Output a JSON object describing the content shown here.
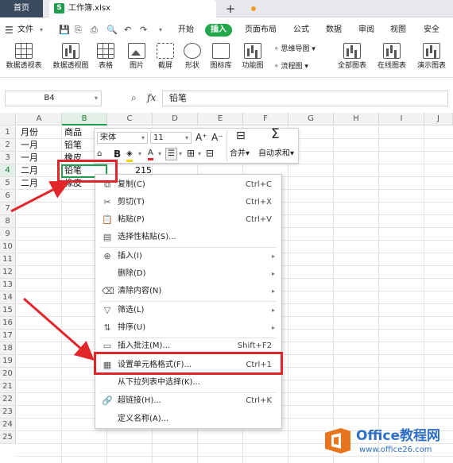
{
  "titlebar": {
    "home_tab": "首页",
    "file_badge": "S",
    "file_tab": "工作簿.xlsx",
    "new_tab": "+"
  },
  "menubar": {
    "file_menu": "文件",
    "tabs": [
      "开始",
      "插入",
      "页面布局",
      "公式",
      "数据",
      "审阅",
      "视图",
      "安全"
    ],
    "active_tab": "插入"
  },
  "ribbon": {
    "buttons": [
      "数据透视表",
      "数据透视图",
      "表格",
      "图片",
      "截屏",
      "形状",
      "图标库",
      "功能图",
      "全部图表",
      "在线图表",
      "演示图表"
    ],
    "small_buttons": [
      "思维导图",
      "流程图"
    ]
  },
  "formula_bar": {
    "cell_ref": "B4",
    "fx": "fx",
    "content": "铅笔"
  },
  "grid": {
    "columns": [
      "A",
      "B",
      "C",
      "D",
      "E",
      "F",
      "G",
      "H",
      "I",
      "J"
    ],
    "selected_column": "B",
    "rows": [
      "1",
      "2",
      "3",
      "4",
      "5",
      "6",
      "7",
      "8",
      "9",
      "10",
      "11",
      "12",
      "13",
      "14",
      "15",
      "16",
      "17",
      "18",
      "19",
      "20",
      "21",
      "22",
      "23",
      "24",
      "25"
    ],
    "selected_row": "4",
    "cells": {
      "A1": "月份",
      "A2": "一月",
      "A3": "一月",
      "A4": "二月",
      "A5": "二月",
      "B1": "商品",
      "B2": "铅笔",
      "B3": "橡皮",
      "B4": "铅笔",
      "B5": "橡皮",
      "C4": "215"
    }
  },
  "mini_toolbar": {
    "font_name": "宋体",
    "font_size": "11",
    "grow_font": "A⁺",
    "shrink_font": "A⁻",
    "bold": "B",
    "merge_label": "合并",
    "autosum_label": "自动求和"
  },
  "context_menu": {
    "items": [
      {
        "label": "复制(C)",
        "shortcut": "Ctrl+C",
        "icon": "copy-icon"
      },
      {
        "label": "剪切(T)",
        "shortcut": "Ctrl+X",
        "icon": "cut-icon"
      },
      {
        "label": "粘贴(P)",
        "shortcut": "Ctrl+V",
        "icon": "paste-icon"
      },
      {
        "label": "选择性粘贴(S)...",
        "shortcut": "",
        "icon": "paste-special-icon"
      },
      {
        "label": "插入(I)",
        "shortcut": "",
        "icon": "insert-icon"
      },
      {
        "label": "删除(D)",
        "shortcut": "",
        "icon": ""
      },
      {
        "label": "清除内容(N)",
        "shortcut": "",
        "icon": "eraser-icon"
      },
      {
        "label": "筛选(L)",
        "shortcut": "",
        "icon": "filter-icon"
      },
      {
        "label": "排序(U)",
        "shortcut": "",
        "icon": "sort-icon"
      },
      {
        "label": "插入批注(M)...",
        "shortcut": "Shift+F2",
        "icon": "comment-icon"
      },
      {
        "label": "设置单元格格式(F)...",
        "shortcut": "Ctrl+1",
        "icon": "format-cells-icon"
      },
      {
        "label": "从下拉列表中选择(K)...",
        "shortcut": "",
        "icon": ""
      },
      {
        "label": "超链接(H)...",
        "shortcut": "Ctrl+K",
        "icon": "link-icon"
      },
      {
        "label": "定义名称(A)...",
        "shortcut": "",
        "icon": ""
      }
    ],
    "highlighted_item": "设置单元格格式(F)..."
  },
  "watermark": {
    "brand": "Office教程网",
    "url": "www.office26.com"
  },
  "colors": {
    "accent_green": "#1f9e50",
    "annotation_red": "#e0262a",
    "watermark_blue": "#2f6fc4",
    "watermark_orange": "#e8741e"
  }
}
